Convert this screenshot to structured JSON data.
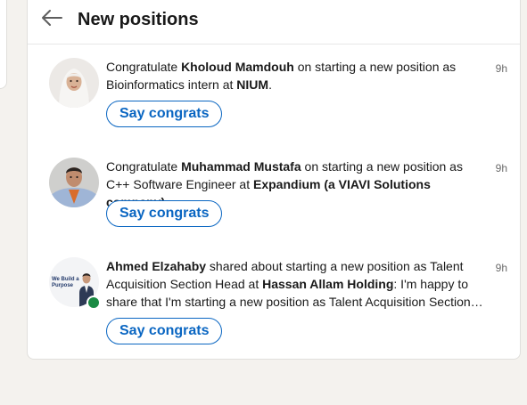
{
  "header": {
    "title": "New positions"
  },
  "items": [
    {
      "prefix": "Congratulate ",
      "name": "Kholoud Mamdouh",
      "middle": " on starting a new position as Bioinformatics intern at ",
      "company": "NIUM",
      "suffix": ".",
      "time": "9h",
      "button": "Say congrats"
    },
    {
      "prefix": "Congratulate ",
      "name": "Muhammad Mustafa",
      "middle": " on starting a new position as C++ Software Engineer at ",
      "company": "Expandium (a VIAVI Solutions company)",
      "suffix": ".",
      "time": "9h",
      "button": "Say congrats"
    },
    {
      "name": "Ahmed Elzahaby",
      "middle": " shared about starting a new position as Talent Acquisition Section Head at ",
      "company": "Hassan Allam Holding",
      "suffix": ": I'm happy to share that I'm starting a new position as Talent Acquisition Section…",
      "time": "9h",
      "button": "Say congrats",
      "avatar_text": {
        "line1": "We Build a",
        "line2": "Purpose"
      }
    }
  ],
  "colors": {
    "accent": "#0a66c2",
    "online": "#1a8a43",
    "background": "#f4f2ee"
  }
}
